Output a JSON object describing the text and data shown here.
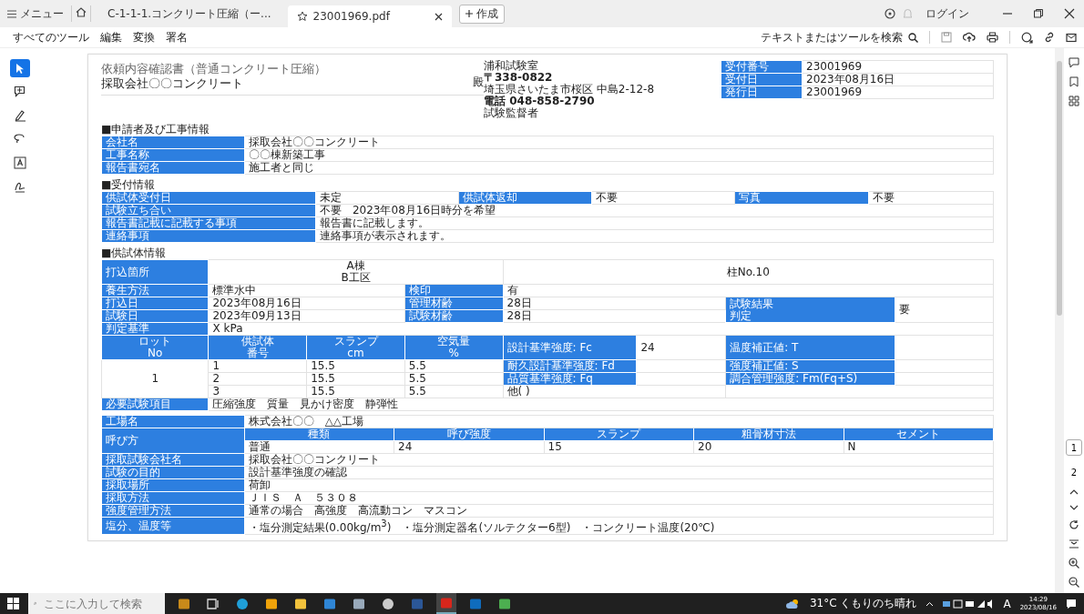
{
  "titlebar": {
    "menu_label": "メニュー",
    "tabs": [
      {
        "label": "C-1-1-1.コンクリート圧縮（ー...",
        "selected": false
      },
      {
        "label": "23001969.pdf",
        "selected": true
      }
    ],
    "create_label": "作成",
    "login_label": "ログイン"
  },
  "toolbar": {
    "menus": [
      "すべてのツール",
      "編集",
      "変換",
      "署名"
    ],
    "search_label": "テキストまたはツールを検索"
  },
  "tools": [
    {
      "kind": "cursor",
      "selected": true
    },
    {
      "kind": "comment",
      "selected": false
    },
    {
      "kind": "pen",
      "selected": false
    },
    {
      "kind": "lasso",
      "selected": false
    },
    {
      "kind": "text",
      "selected": false
    },
    {
      "kind": "sign",
      "selected": false
    }
  ],
  "page_numbers": [
    {
      "label": "1",
      "selected": true
    },
    {
      "label": "2",
      "selected": false
    }
  ],
  "document": {
    "title": "依頼内容確認書（普通コンクリート圧縮）",
    "company": "採取会社〇〇コンクリート",
    "honorific": "殿",
    "info": [
      {
        "label": "受付番号",
        "value": "23001969"
      },
      {
        "label": "受付日",
        "value": "2023年08月16日"
      },
      {
        "label": "発行日",
        "value": "23001969"
      }
    ],
    "address": [
      {
        "text": "浦和試験室",
        "bold": false
      },
      {
        "text": "〒338-0822",
        "bold": true
      },
      {
        "text": "埼玉県さいたま市桜区 中島2-12-8",
        "bold": false
      },
      {
        "text": "電話 048-858-2790",
        "bold": true
      },
      {
        "text": "試験監督者",
        "bold": false
      }
    ],
    "sections": [
      {
        "heading": "■申請者及び工事情報",
        "table": {
          "kind": "pairs",
          "rows": [
            [
              {
                "kind": "label",
                "text": "会社名"
              },
              {
                "kind": "value",
                "text": "採取会社〇〇コンクリート"
              }
            ],
            [
              {
                "kind": "label",
                "text": "工事名称"
              },
              {
                "kind": "value",
                "text": "〇〇棟新築工事"
              }
            ],
            [
              {
                "kind": "label",
                "text": "報告書宛名"
              },
              {
                "kind": "value",
                "text": "施工者と同じ"
              }
            ]
          ]
        }
      },
      {
        "heading": "■受付情報",
        "table": {
          "kind": "reception",
          "rows": [
            [
              {
                "kind": "label",
                "text": "供試体受付日"
              },
              {
                "kind": "value",
                "text": "未定"
              },
              {
                "kind": "label",
                "text": "供試体返却"
              },
              {
                "kind": "value",
                "text": "不要"
              },
              {
                "kind": "label",
                "text": "写真"
              },
              {
                "kind": "value",
                "text": "不要"
              }
            ],
            [
              {
                "kind": "label",
                "text": "試験立ち合い"
              },
              {
                "kind": "value",
                "text": "不要　2023年08月16日時分を希望",
                "colspan": 5
              }
            ],
            [
              {
                "kind": "label",
                "text": "報告書記載に記載する事項"
              },
              {
                "kind": "value",
                "text": "報告書に記載します。",
                "colspan": 5
              }
            ],
            [
              {
                "kind": "label",
                "text": "連絡事項"
              },
              {
                "kind": "value",
                "text": "連絡事項が表示されます。",
                "colspan": 5
              }
            ]
          ]
        }
      },
      {
        "heading": "■供試体情報",
        "table": {
          "kind": "specimen",
          "rows": [
            [
              {
                "kind": "label",
                "text": "打込箇所"
              },
              {
                "kind": "cvalue",
                "lines": [
                  "A棟",
                  "B工区"
                ],
                "colspan": 3
              },
              {
                "kind": "cvalue",
                "text": "柱No.10",
                "colspan": 4
              }
            ],
            [
              {
                "kind": "label",
                "text": "養生方法"
              },
              {
                "kind": "value",
                "text": "標準水中",
                "colspan": 2
              },
              {
                "kind": "label",
                "text": "検印"
              },
              {
                "kind": "value",
                "text": "有",
                "colspan": 4
              }
            ],
            [
              {
                "kind": "label",
                "text": "打込日"
              },
              {
                "kind": "value",
                "text": "2023年08月16日",
                "colspan": 2
              },
              {
                "kind": "label",
                "text": "管理材齢"
              },
              {
                "kind": "value",
                "text": "28日",
                "colspan": 2
              },
              {
                "kind": "label",
                "lines": [
                  "試験結果",
                  "判定"
                ],
                "rowspan": 2
              },
              {
                "kind": "value",
                "text": "要",
                "rowspan": 2
              }
            ],
            [
              {
                "kind": "label",
                "text": "試験日"
              },
              {
                "kind": "value",
                "text": "2023年09月13日",
                "colspan": 2
              },
              {
                "kind": "label",
                "text": "試験材齢"
              },
              {
                "kind": "value",
                "text": "28日",
                "colspan": 2
              }
            ],
            [
              {
                "kind": "label",
                "text": "判定基準"
              },
              {
                "kind": "value",
                "text": "X kPa",
                "colspan": 7
              }
            ],
            [
              {
                "kind": "colhead",
                "lines": [
                  "ロット",
                  "No"
                ]
              },
              {
                "kind": "colhead",
                "lines": [
                  "供試体",
                  "番号"
                ]
              },
              {
                "kind": "colhead",
                "lines": [
                  "スランプ",
                  "cm"
                ]
              },
              {
                "kind": "colhead",
                "lines": [
                  "空気量",
                  "%"
                ]
              },
              {
                "kind": "label",
                "text": "設計基準強度: Fc"
              },
              {
                "kind": "value",
                "text": "24"
              },
              {
                "kind": "label",
                "text": "温度補正値: T"
              },
              {
                "kind": "value"
              }
            ],
            [
              {
                "kind": "cvalue",
                "text": "1",
                "rowspan": 3
              },
              {
                "kind": "value",
                "text": "1"
              },
              {
                "kind": "value",
                "text": "15.5"
              },
              {
                "kind": "value",
                "text": "5.5"
              },
              {
                "kind": "label",
                "text": "耐久設計基準強度: Fd"
              },
              {
                "kind": "value"
              },
              {
                "kind": "label",
                "text": "強度補正値: S"
              },
              {
                "kind": "value"
              }
            ],
            [
              {
                "kind": "value",
                "text": "2"
              },
              {
                "kind": "value",
                "text": "15.5"
              },
              {
                "kind": "value",
                "text": "5.5"
              },
              {
                "kind": "label",
                "text": "品質基準強度: Fq"
              },
              {
                "kind": "value"
              },
              {
                "kind": "label",
                "text": "調合管理強度: Fm(Fq+S)"
              },
              {
                "kind": "value"
              }
            ],
            [
              {
                "kind": "value",
                "text": "3"
              },
              {
                "kind": "value",
                "text": "15.5"
              },
              {
                "kind": "value",
                "text": "5.5"
              },
              {
                "kind": "value",
                "text": "他( )",
                "colspan": 2
              },
              {
                "kind": "value",
                "colspan": 2
              }
            ],
            [
              {
                "kind": "label",
                "text": "必要試験項目"
              },
              {
                "kind": "value",
                "text": "圧縮強度　質量　見かけ密度　静弾性",
                "colspan": 7
              }
            ]
          ]
        }
      },
      {
        "table": {
          "kind": "factory",
          "rows": [
            [
              {
                "kind": "label",
                "text": "工場名"
              },
              {
                "kind": "value",
                "text": "株式会社〇〇　△△工場",
                "colspan": 5
              }
            ],
            [
              {
                "kind": "label",
                "text": "呼び方",
                "rowspan": 2
              },
              {
                "kind": "colhead",
                "text": "種類"
              },
              {
                "kind": "colhead",
                "text": "呼び強度"
              },
              {
                "kind": "colhead",
                "text": "スランプ"
              },
              {
                "kind": "colhead",
                "text": "粗骨材寸法"
              },
              {
                "kind": "colhead",
                "text": "セメント"
              }
            ],
            [
              {
                "kind": "value",
                "text": "普通"
              },
              {
                "kind": "value",
                "text": "24"
              },
              {
                "kind": "value",
                "text": "15"
              },
              {
                "kind": "value",
                "text": "20"
              },
              {
                "kind": "value",
                "text": "N"
              }
            ],
            [
              {
                "kind": "label",
                "text": "採取試験会社名"
              },
              {
                "kind": "value",
                "text": "採取会社〇〇コンクリート",
                "colspan": 5
              }
            ],
            [
              {
                "kind": "label",
                "text": "試験の目的"
              },
              {
                "kind": "value",
                "text": "設計基準強度の確認",
                "colspan": 5
              }
            ],
            [
              {
                "kind": "label",
                "text": "採取場所"
              },
              {
                "kind": "value",
                "text": "荷卸",
                "colspan": 5
              }
            ],
            [
              {
                "kind": "label",
                "text": "採取方法"
              },
              {
                "kind": "value",
                "text": "ＪＩＳ　Ａ　５３０８",
                "colspan": 5
              }
            ],
            [
              {
                "kind": "label",
                "text": "強度管理方法"
              },
              {
                "kind": "value",
                "text": "通常の場合　高強度　高流動コン　マスコン",
                "colspan": 5
              }
            ],
            [
              {
                "kind": "label",
                "text": "塩分、温度等"
              },
              {
                "kind": "value",
                "text": "・塩分測定結果(0.00kg/m$^{3}$)　・塩分測定器名(ソルテクター6型)　・コンクリート温度(20℃)",
                "colspan": 5
              }
            ]
          ]
        }
      }
    ]
  },
  "taskbar": {
    "search_placeholder": "ここに入力して検索",
    "apps": [
      {
        "kind": "briefcase",
        "selected": false
      },
      {
        "kind": "taskview",
        "selected": false
      },
      {
        "kind": "edge",
        "selected": false
      },
      {
        "kind": "store",
        "selected": false
      },
      {
        "kind": "folder",
        "selected": false
      },
      {
        "kind": "mail",
        "selected": false
      },
      {
        "kind": "note",
        "selected": false
      },
      {
        "kind": "person",
        "selected": false
      },
      {
        "kind": "word",
        "selected": false
      },
      {
        "kind": "acrobat",
        "selected": true
      },
      {
        "kind": "outlook",
        "selected": false
      },
      {
        "kind": "tool",
        "selected": false
      }
    ],
    "weather": "31°C くもりのち晴れ",
    "ime": "A",
    "time": "14:29",
    "date": "2023/08/16"
  }
}
